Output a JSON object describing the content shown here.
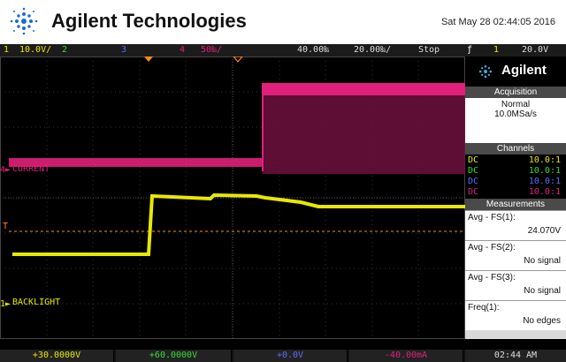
{
  "header": {
    "brand": "Agilent Technologies",
    "datetime": "Sat May 28 02:44:05 2016"
  },
  "statusbar": {
    "ch1_num": "1",
    "ch1_scale": "10.0V/",
    "ch2_num": "2",
    "ch3_num": "3",
    "ch4_num": "4",
    "ch4_scale": "50‰/",
    "delay": "40.00‰",
    "timebase": "20.00‰/",
    "run_state": "Stop",
    "trigger_symbol": "ƒ",
    "trigger_ch": "1",
    "trigger_level": "20.0V"
  },
  "screen": {
    "ch4_label": "CURRENT",
    "ch4_marker": "4",
    "ch1_label": "BACKLIGHT",
    "ch1_marker": "1",
    "trigger_marker": "T"
  },
  "sidebar": {
    "brand": "Agilent",
    "acquisition": {
      "title": "Acquisition",
      "mode": "Normal",
      "rate": "10.0MSa/s"
    },
    "channels": {
      "title": "Channels",
      "rows": [
        {
          "coupling": "DC",
          "probe": "10.0:1",
          "color": "#e8e800"
        },
        {
          "coupling": "DC",
          "probe": "10.0:1",
          "color": "#33dd33"
        },
        {
          "coupling": "DC",
          "probe": "10.0:1",
          "color": "#5a6bff"
        },
        {
          "coupling": "DC",
          "probe": "10.0:1",
          "color": "#e0207a"
        }
      ]
    },
    "measurements": {
      "title": "Measurements",
      "items": [
        {
          "name": "Avg - FS(1):",
          "value": "24.070V"
        },
        {
          "name": "Avg - FS(2):",
          "value": "No signal"
        },
        {
          "name": "Avg - FS(3):",
          "value": "No signal"
        },
        {
          "name": "Freq(1):",
          "value": "No edges"
        }
      ]
    }
  },
  "bottombar": {
    "ch1": "+30.0000V",
    "ch2": "+60.0000V",
    "ch3": "+0.0V",
    "ch4": "-40.00mA",
    "time": "02:44 AM"
  },
  "colors": {
    "ch1": "#e8e800",
    "ch2": "#33dd33",
    "ch3": "#5a6bff",
    "ch4": "#e0207a",
    "accent_orange": "#ff8a1a"
  }
}
